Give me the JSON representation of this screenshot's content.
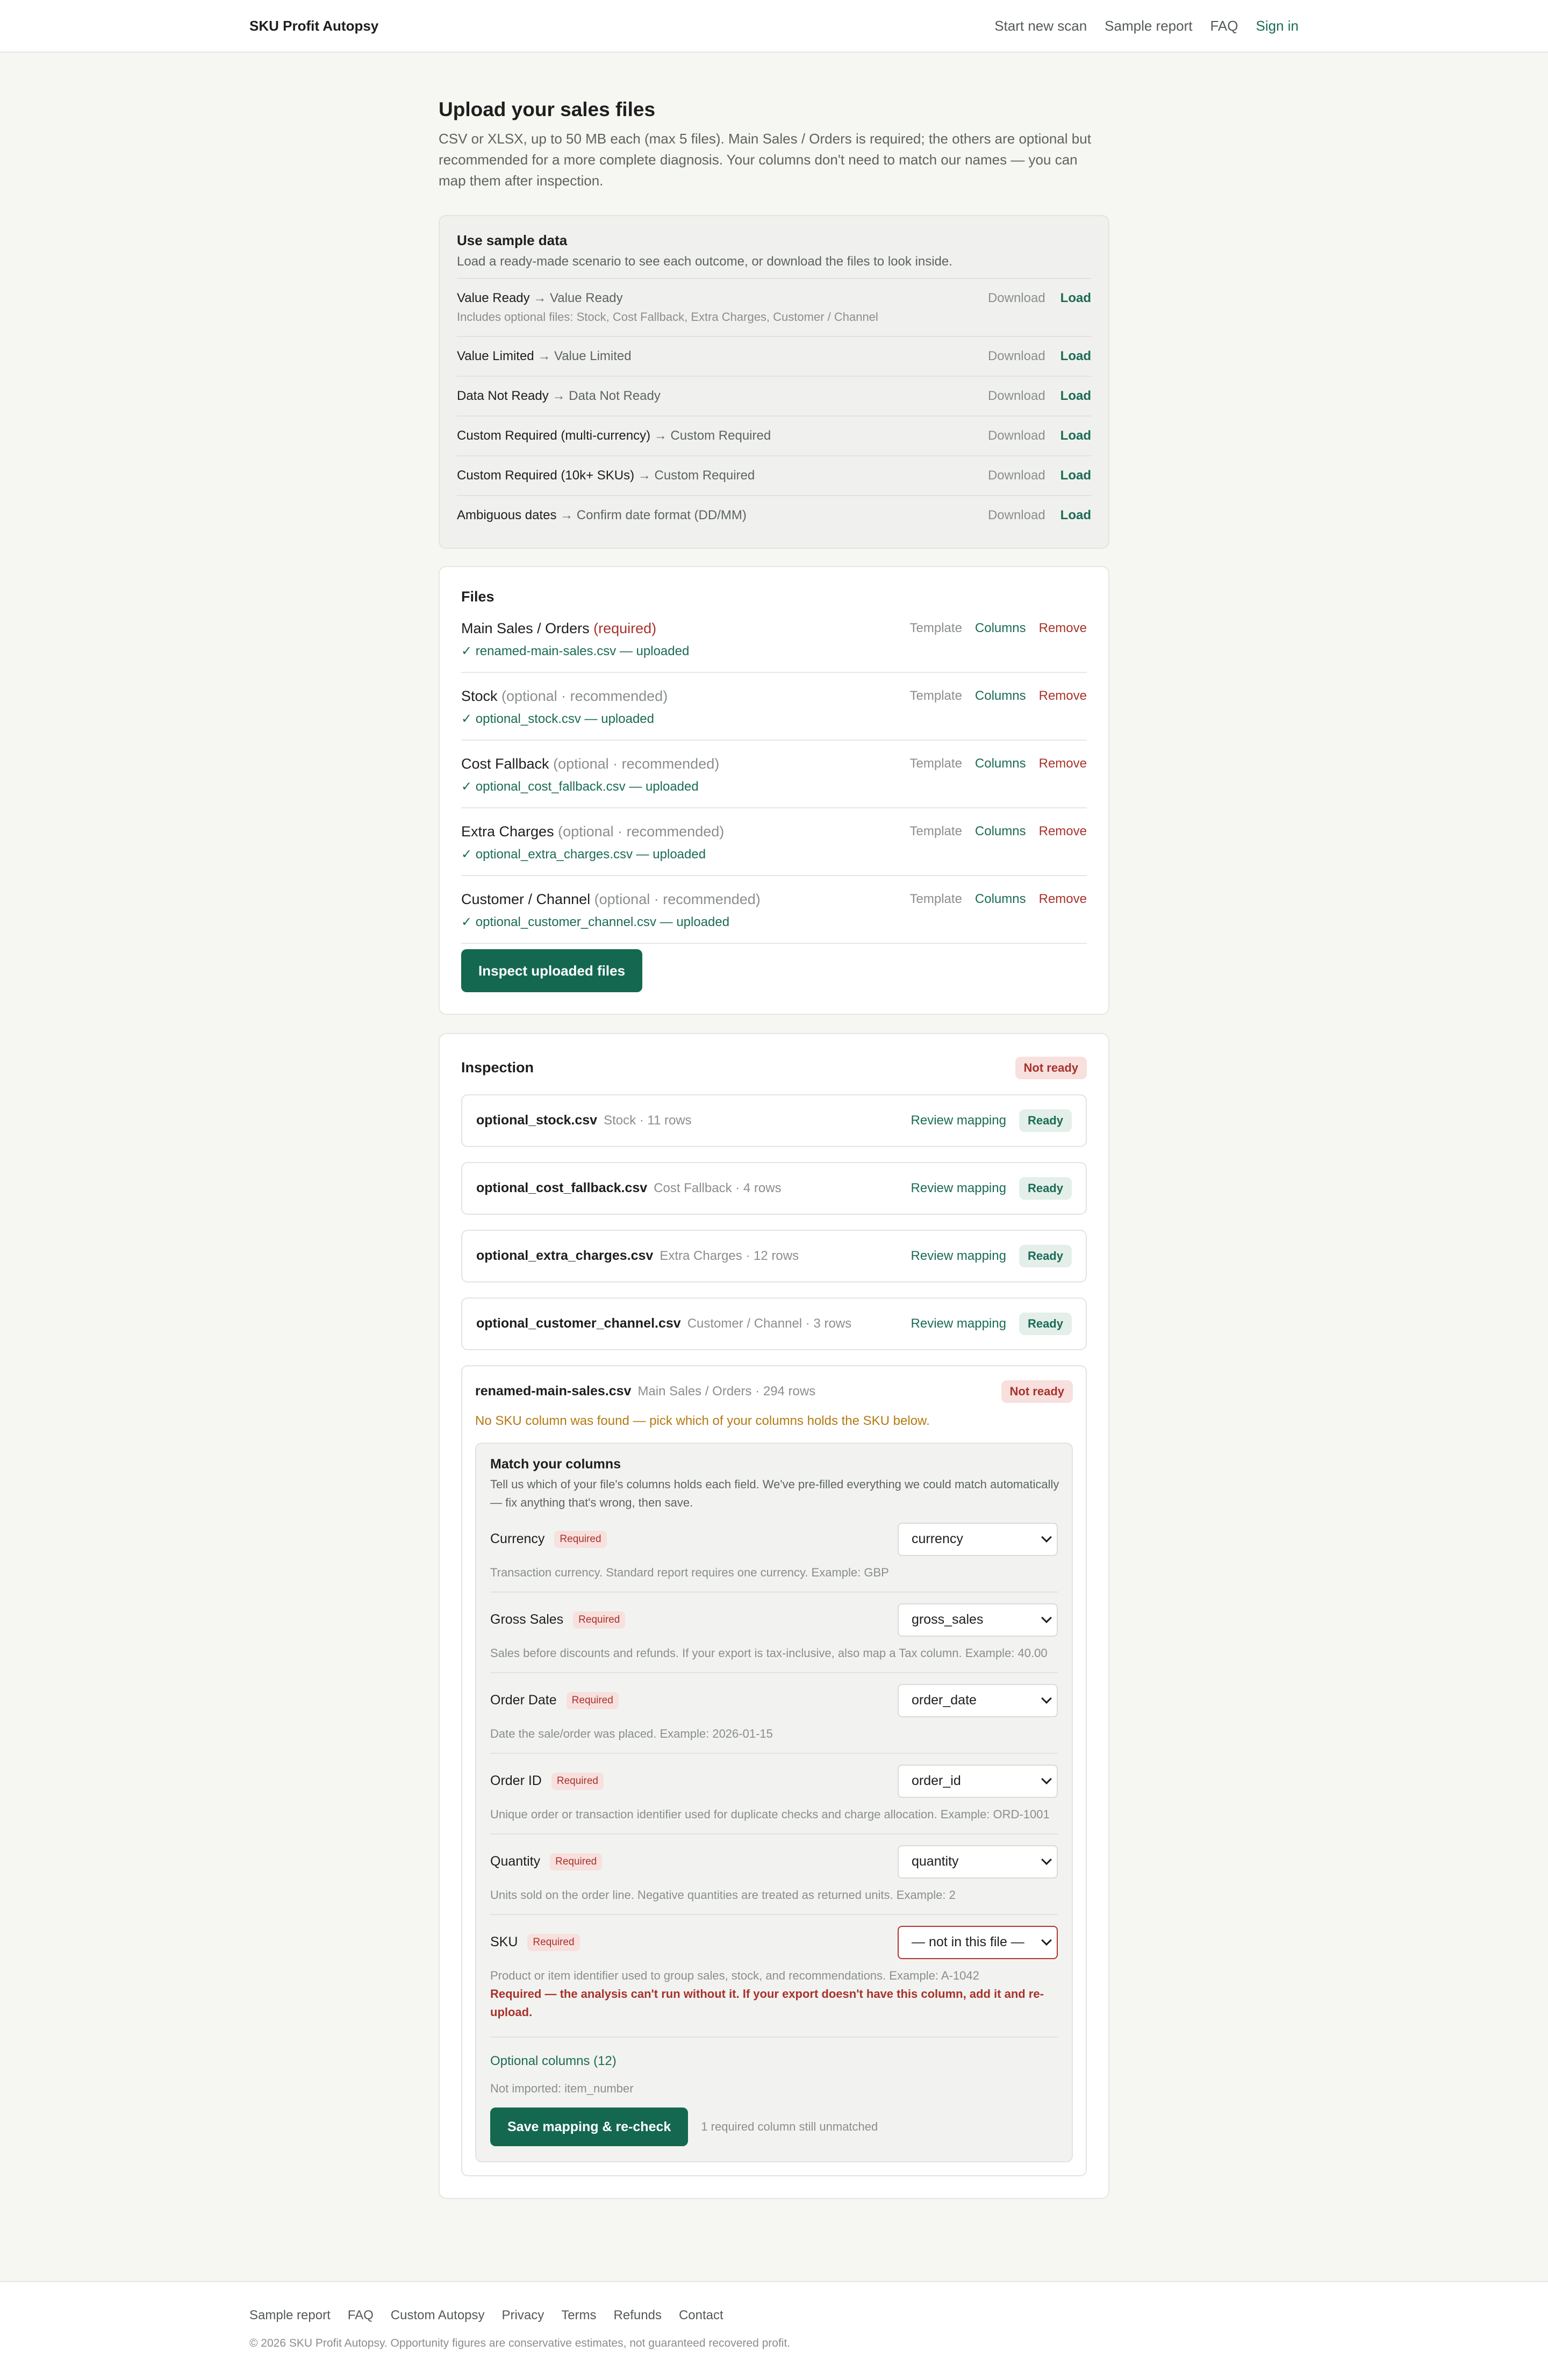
{
  "nav": {
    "brand": "SKU Profit Autopsy",
    "links": [
      "Start new scan",
      "Sample report",
      "FAQ"
    ],
    "signin": "Sign in"
  },
  "upload": {
    "title": "Upload your sales files",
    "intro": "CSV or XLSX, up to 50 MB each (max 5 files). Main Sales / Orders is required; the others are optional but recommended for a more complete diagnosis. Your columns don't need to match our names — you can map them after inspection."
  },
  "sample": {
    "title": "Use sample data",
    "desc": "Load a ready-made scenario to see each outcome, or download the files to look inside.",
    "download_label": "Download",
    "load_label": "Load",
    "items": [
      {
        "name": "Value Ready",
        "outcome": "→ Value Ready",
        "includes": "Includes optional files: Stock, Cost Fallback, Extra Charges, Customer / Channel"
      },
      {
        "name": "Value Limited",
        "outcome": "→ Value Limited",
        "includes": ""
      },
      {
        "name": "Data Not Ready",
        "outcome": "→ Data Not Ready",
        "includes": ""
      },
      {
        "name": "Custom Required (multi-currency)",
        "outcome": "→ Custom Required",
        "includes": ""
      },
      {
        "name": "Custom Required (10k+ SKUs)",
        "outcome": "→ Custom Required",
        "includes": ""
      },
      {
        "name": "Ambiguous dates",
        "outcome": "→ Confirm date format (DD/MM)",
        "includes": ""
      }
    ]
  },
  "files": {
    "title": "Files",
    "template_label": "Template",
    "columns_label": "Columns",
    "remove_label": "Remove",
    "items": [
      {
        "name": "Main Sales / Orders",
        "tag": "(required)",
        "status": "✓ renamed-main-sales.csv — uploaded"
      },
      {
        "name": "Stock",
        "tag": "(optional · recommended)",
        "status": "✓ optional_stock.csv — uploaded"
      },
      {
        "name": "Cost Fallback",
        "tag": "(optional · recommended)",
        "status": "✓ optional_cost_fallback.csv — uploaded"
      },
      {
        "name": "Extra Charges",
        "tag": "(optional · recommended)",
        "status": "✓ optional_extra_charges.csv — uploaded"
      },
      {
        "name": "Customer / Channel",
        "tag": "(optional · recommended)",
        "status": "✓ optional_customer_channel.csv — uploaded"
      }
    ],
    "inspect_button": "Inspect uploaded files"
  },
  "inspection": {
    "title": "Inspection",
    "status": "Not ready",
    "review_label": "Review mapping",
    "items": [
      {
        "file": "optional_stock.csv",
        "meta": "Stock · 11 rows",
        "status": "Ready"
      },
      {
        "file": "optional_cost_fallback.csv",
        "meta": "Cost Fallback · 4 rows",
        "status": "Ready"
      },
      {
        "file": "optional_extra_charges.csv",
        "meta": "Extra Charges · 12 rows",
        "status": "Ready"
      },
      {
        "file": "optional_customer_channel.csv",
        "meta": "Customer / Channel · 3 rows",
        "status": "Ready"
      }
    ],
    "main": {
      "file": "renamed-main-sales.csv",
      "meta": "Main Sales / Orders · 294 rows",
      "status": "Not ready",
      "warning": "No SKU column was found — pick which of your columns holds the SKU below.",
      "match": {
        "title": "Match your columns",
        "desc": "Tell us which of your file's columns holds each field. We've pre-filled everything we could match automatically — fix anything that's wrong, then save.",
        "required_label": "Required",
        "fields": [
          {
            "label": "Currency",
            "value": "currency",
            "help": "Transaction currency. Standard report requires one currency. Example: GBP",
            "error": ""
          },
          {
            "label": "Gross Sales",
            "value": "gross_sales",
            "help": "Sales before discounts and refunds. If your export is tax-inclusive, also map a Tax column. Example: 40.00",
            "error": ""
          },
          {
            "label": "Order Date",
            "value": "order_date",
            "help": "Date the sale/order was placed. Example: 2026-01-15",
            "error": ""
          },
          {
            "label": "Order ID",
            "value": "order_id",
            "help": "Unique order or transaction identifier used for duplicate checks and charge allocation. Example: ORD-1001",
            "error": ""
          },
          {
            "label": "Quantity",
            "value": "quantity",
            "help": "Units sold on the order line. Negative quantities are treated as returned units. Example: 2",
            "error": ""
          },
          {
            "label": "SKU",
            "value": "— not in this file —",
            "help": "Product or item identifier used to group sales, stock, and recommendations. Example: A-1042",
            "error": "Required — the analysis can't run without it. If your export doesn't have this column, add it and re-upload."
          }
        ],
        "optional_columns": "Optional columns (12)",
        "not_imported": "Not imported: item_number",
        "save_button": "Save mapping & re-check",
        "unmatched": "1 required column still unmatched"
      }
    }
  },
  "footer": {
    "links": [
      "Sample report",
      "FAQ",
      "Custom Autopsy",
      "Privacy",
      "Terms",
      "Refunds",
      "Contact"
    ],
    "note": "© 2026 SKU Profit Autopsy. Opportunity figures are conservative estimates, not guaranteed recovered profit."
  }
}
